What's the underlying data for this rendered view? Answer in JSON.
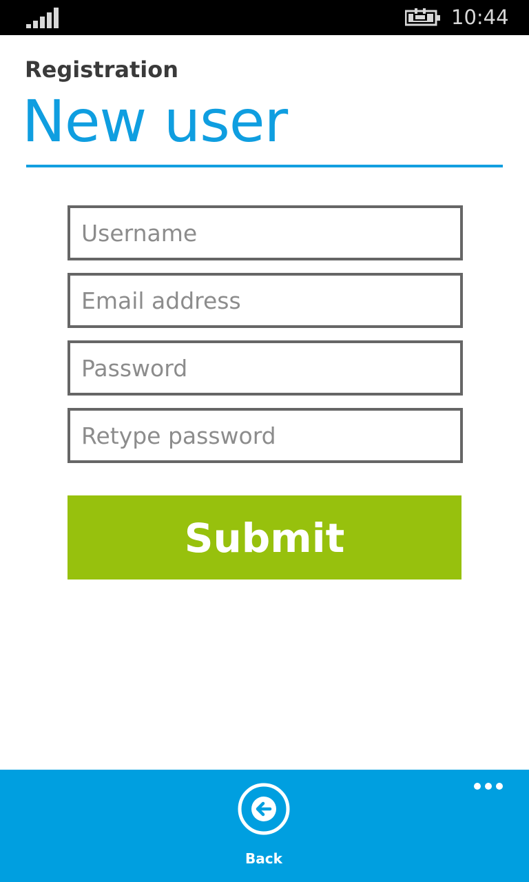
{
  "status_bar": {
    "time": "10:44",
    "signal_icon": "signal-bars-icon",
    "battery_icon": "battery-charging-icon"
  },
  "header": {
    "app_name": "Registration",
    "page_title": "New user"
  },
  "form": {
    "username": {
      "placeholder": "Username",
      "value": ""
    },
    "email": {
      "placeholder": "Email address",
      "value": ""
    },
    "password": {
      "placeholder": "Password",
      "value": ""
    },
    "retype_password": {
      "placeholder": "Retype password",
      "value": ""
    },
    "submit_label": "Submit"
  },
  "app_bar": {
    "back_label": "Back",
    "back_icon": "arrow-left-circle-icon",
    "more_icon": "ellipsis-icon"
  },
  "colors": {
    "accent": "#0f9ee0",
    "submit": "#97c10d",
    "app_bar": "#009fe0",
    "field_border": "#666666"
  }
}
